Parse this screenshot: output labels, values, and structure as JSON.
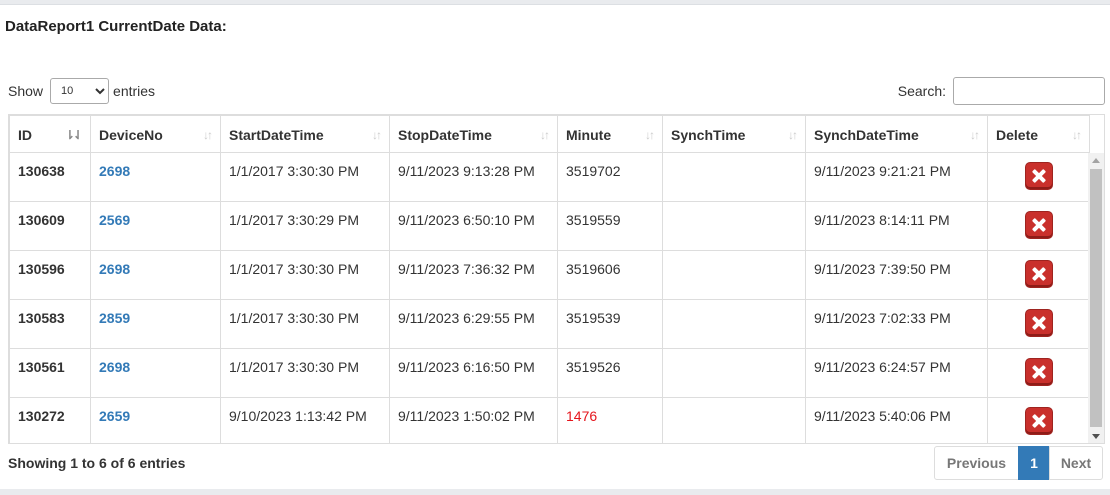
{
  "title": "DataReport1 CurrentDate Data:",
  "length": {
    "show_label": "Show",
    "selected": "10",
    "entries_label": "entries"
  },
  "search": {
    "label": "Search:",
    "value": ""
  },
  "columns": [
    "ID",
    "DeviceNo",
    "StartDateTime",
    "StopDateTime",
    "Minute",
    "SynchTime",
    "SynchDateTime",
    "Delete"
  ],
  "rows": [
    {
      "id": "130638",
      "device": "2698",
      "start": "1/1/2017 3:30:30 PM",
      "stop": "9/11/2023 9:13:28 PM",
      "minute": "3519702",
      "synch_time": "",
      "synch_date": "9/11/2023 9:21:21 PM"
    },
    {
      "id": "130609",
      "device": "2569",
      "start": "1/1/2017 3:30:29 PM",
      "stop": "9/11/2023 6:50:10 PM",
      "minute": "3519559",
      "synch_time": "",
      "synch_date": "9/11/2023 8:14:11 PM"
    },
    {
      "id": "130596",
      "device": "2698",
      "start": "1/1/2017 3:30:30 PM",
      "stop": "9/11/2023 7:36:32 PM",
      "minute": "3519606",
      "synch_time": "",
      "synch_date": "9/11/2023 7:39:50 PM"
    },
    {
      "id": "130583",
      "device": "2859",
      "start": "1/1/2017 3:30:30 PM",
      "stop": "9/11/2023 6:29:55 PM",
      "minute": "3519539",
      "synch_time": "",
      "synch_date": "9/11/2023 7:02:33 PM"
    },
    {
      "id": "130561",
      "device": "2698",
      "start": "1/1/2017 3:30:30 PM",
      "stop": "9/11/2023 6:16:50 PM",
      "minute": "3519526",
      "synch_time": "",
      "synch_date": "9/11/2023 6:24:57 PM"
    },
    {
      "id": "130272",
      "device": "2659",
      "start": "9/10/2023 1:13:42 PM",
      "stop": "9/11/2023 1:50:02 PM",
      "minute": "1476",
      "synch_time": "",
      "synch_date": "9/11/2023 5:40:06 PM"
    }
  ],
  "info": "Showing 1 to 6 of 6 entries",
  "pagination": {
    "previous": "Previous",
    "current": "1",
    "next": "Next"
  },
  "colors": {
    "link": "#337ab7",
    "alert": "#e5151c",
    "delete": "#c9302c"
  },
  "icons": {
    "delete": "close-x-icon",
    "sort": "sort-arrows-icon"
  }
}
